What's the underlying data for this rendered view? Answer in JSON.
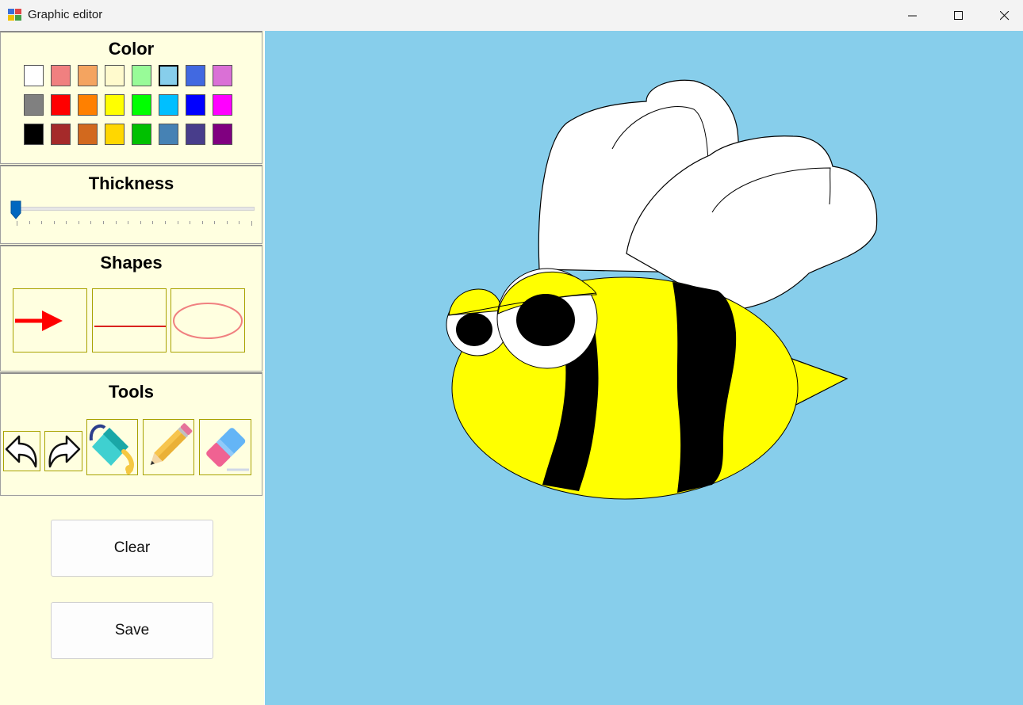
{
  "window": {
    "title": "Graphic editor"
  },
  "panel": {
    "color": {
      "title": "Color",
      "swatches": [
        [
          "#ffffff",
          "#f08080",
          "#f4a460",
          "#fffacd",
          "#98fb98",
          "#87ceeb",
          "#4169e1",
          "#da70d6"
        ],
        [
          "#808080",
          "#ff0000",
          "#ff8000",
          "#ffff00",
          "#00ff00",
          "#00bfff",
          "#0000ff",
          "#ff00ff"
        ],
        [
          "#000000",
          "#a52a2a",
          "#d2691e",
          "#ffd700",
          "#00c000",
          "#4682b4",
          "#483d8b",
          "#800080"
        ]
      ],
      "selected": "#87ceeb"
    },
    "thickness": {
      "title": "Thickness",
      "value": 1,
      "min": 1,
      "max": 20
    },
    "shapes": {
      "title": "Shapes",
      "items": [
        "arrow",
        "line",
        "ellipse"
      ]
    },
    "tools": {
      "title": "Tools",
      "items": [
        "undo",
        "redo",
        "fill",
        "pencil",
        "eraser"
      ]
    },
    "clear_label": "Clear",
    "save_label": "Save"
  },
  "canvas": {
    "background": "#87ceeb",
    "drawing": "bee"
  }
}
